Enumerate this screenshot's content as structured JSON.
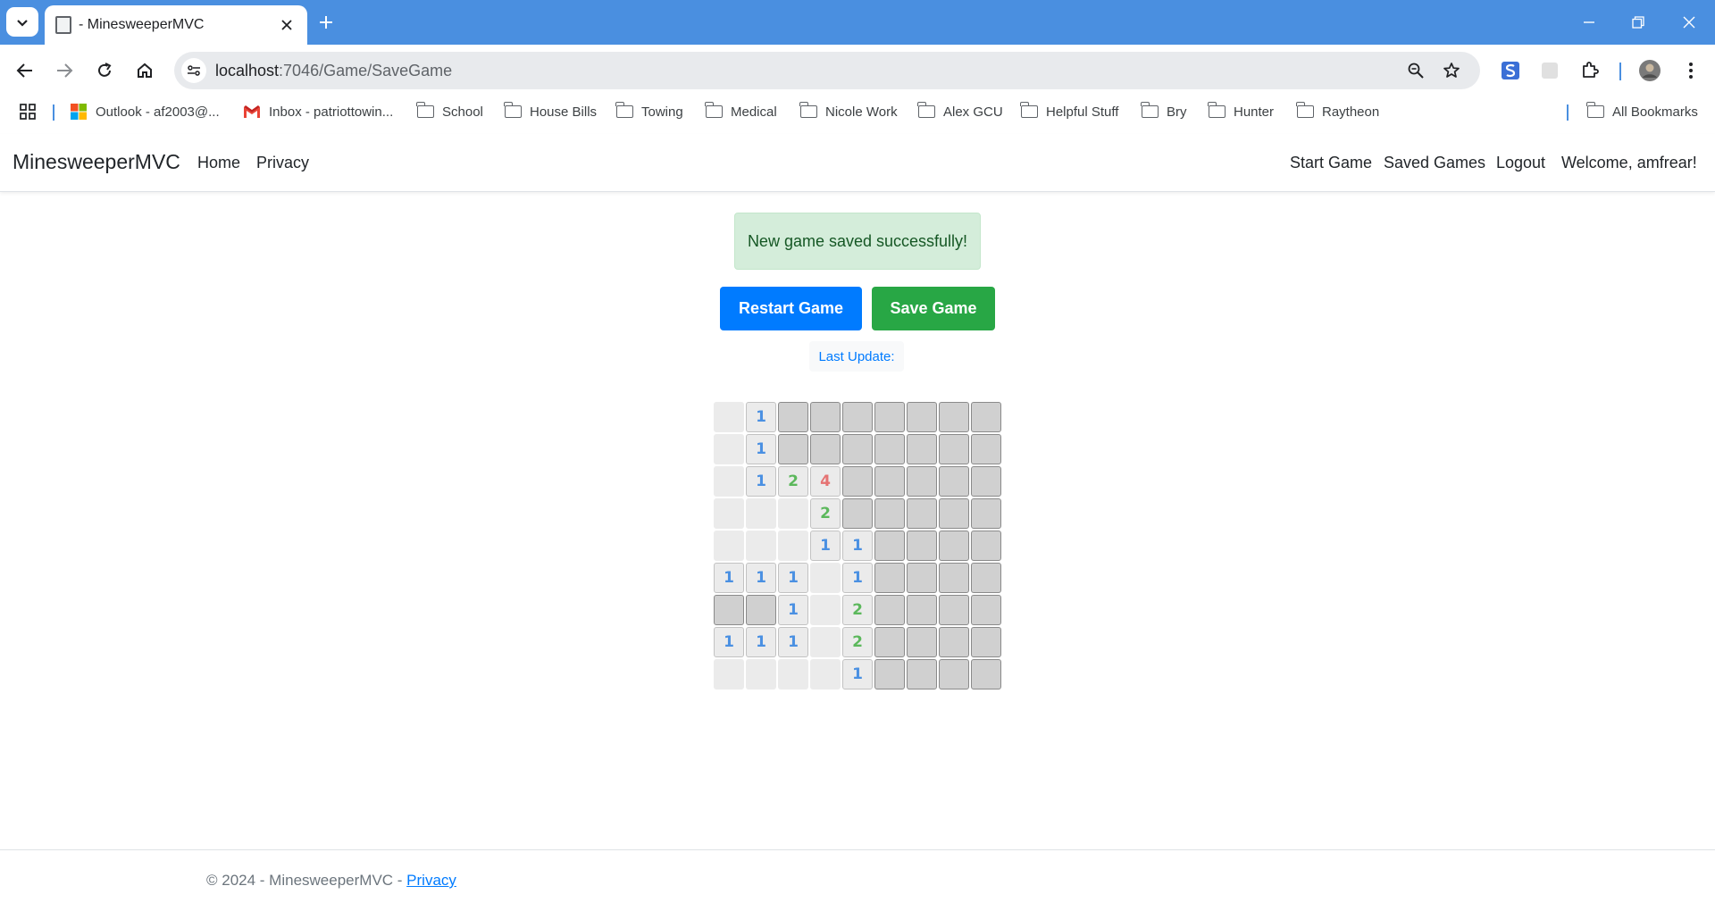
{
  "browser": {
    "tab_title": "- MinesweeperMVC",
    "url_host": "localhost",
    "url_path": ":7046/Game/SaveGame",
    "bookmarks": [
      {
        "label": "Outlook - af2003@...",
        "icon": "microsoft-icon"
      },
      {
        "label": "Inbox - patriottowin...",
        "icon": "gmail-icon"
      },
      {
        "label": "School",
        "icon": "folder-icon"
      },
      {
        "label": "House Bills",
        "icon": "folder-icon"
      },
      {
        "label": "Towing",
        "icon": "folder-icon"
      },
      {
        "label": "Medical",
        "icon": "folder-icon"
      },
      {
        "label": "Nicole Work",
        "icon": "folder-icon"
      },
      {
        "label": "Alex GCU",
        "icon": "folder-icon"
      },
      {
        "label": "Helpful Stuff",
        "icon": "folder-icon"
      },
      {
        "label": "Bry",
        "icon": "folder-icon"
      },
      {
        "label": "Hunter",
        "icon": "folder-icon"
      },
      {
        "label": "Raytheon",
        "icon": "folder-icon"
      }
    ],
    "all_bookmarks": "All Bookmarks"
  },
  "nav": {
    "brand": "MinesweeperMVC",
    "home": "Home",
    "privacy": "Privacy",
    "start_game": "Start Game",
    "saved_games": "Saved Games",
    "logout": "Logout",
    "welcome": "Welcome, amfrear!"
  },
  "main": {
    "alert": "New game saved successfully!",
    "restart_button": "Restart Game",
    "save_button": "Save Game",
    "last_update": "Last Update:"
  },
  "board": {
    "size": 9,
    "legend": "H = hidden, 0 = revealed empty, 1-8 = adjacent mine count",
    "rows": [
      [
        "0",
        "1",
        "H",
        "H",
        "H",
        "H",
        "H",
        "H",
        "H"
      ],
      [
        "0",
        "1",
        "H",
        "H",
        "H",
        "H",
        "H",
        "H",
        "H"
      ],
      [
        "0",
        "1",
        "2",
        "4",
        "H",
        "H",
        "H",
        "H",
        "H"
      ],
      [
        "0",
        "0",
        "0",
        "2",
        "H",
        "H",
        "H",
        "H",
        "H"
      ],
      [
        "0",
        "0",
        "0",
        "1",
        "1",
        "H",
        "H",
        "H",
        "H"
      ],
      [
        "1",
        "1",
        "1",
        "0",
        "1",
        "H",
        "H",
        "H",
        "H"
      ],
      [
        "H",
        "H",
        "1",
        "0",
        "2",
        "H",
        "H",
        "H",
        "H"
      ],
      [
        "1",
        "1",
        "1",
        "0",
        "2",
        "H",
        "H",
        "H",
        "H"
      ],
      [
        "0",
        "0",
        "0",
        "0",
        "1",
        "H",
        "H",
        "H",
        "H"
      ]
    ],
    "number_colors": {
      "1": "#4a90e2",
      "2": "#5cb85c",
      "4": "#e57373"
    }
  },
  "footer": {
    "text": "© 2024 - MinesweeperMVC - ",
    "privacy_link": "Privacy"
  }
}
